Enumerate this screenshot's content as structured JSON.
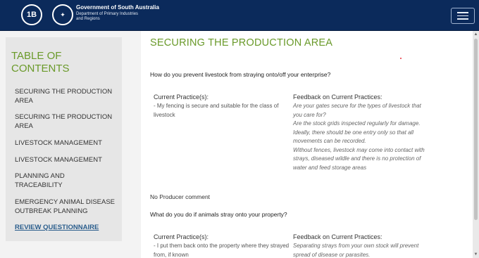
{
  "header": {
    "logo_badge": "1B",
    "crest_glyph": "✦",
    "gov_title": "Government of South Australia",
    "dept_line1": "Department of Primary Industries",
    "dept_line2": "and Regions",
    "menu_icon": "hamburger-menu-icon"
  },
  "toc": {
    "title": "TABLE OF CONTENTS",
    "items": [
      {
        "label": "SECURING THE PRODUCTION AREA"
      },
      {
        "label": "SECURING THE PRODUCTION AREA"
      },
      {
        "label": "LIVESTOCK MANAGEMENT"
      },
      {
        "label": "LIVESTOCK MANAGEMENT"
      },
      {
        "label": "PLANNING AND TRACEABILITY"
      },
      {
        "label": "EMERGENCY ANIMAL DISEASE OUTBREAK PLANNING"
      },
      {
        "label": "REVIEW QUESTIONNAIRE"
      }
    ]
  },
  "main": {
    "page_title": "SECURING THE PRODUCTION AREA",
    "questions": [
      {
        "question": "How do you prevent livestock from straying onto/off your enterprise?",
        "practice_label": "Current Practice(s):",
        "practice": "- My fencing is secure and suitable for the class of livestock",
        "feedback_label": "Feedback on Current Practices:",
        "feedback": [
          "Are your gates secure for the types of livestock that you care for?",
          "Are the stock grids inspected regularly for damage.",
          "Ideally, there should be one entry only so that all movements can be recorded.",
          "Without fences, livestock may come into contact with strays, diseased wildle and there is no protection of water and feed storage areas"
        ],
        "comment": "No Producer comment"
      },
      {
        "question": "What do you do if animals stray onto your property?",
        "practice_label": "Current Practice(s):",
        "practice": "- I put them back onto the property where they strayed from, if known",
        "feedback_label": "Feedback on Current Practices:",
        "feedback": [
          "Separating strays from your own stock will prevent spread of disease or parasites."
        ]
      }
    ]
  },
  "colors": {
    "header_bg": "#0b2a5b",
    "accent_green": "#6a9a2a",
    "link_blue": "#2a5d8c"
  }
}
